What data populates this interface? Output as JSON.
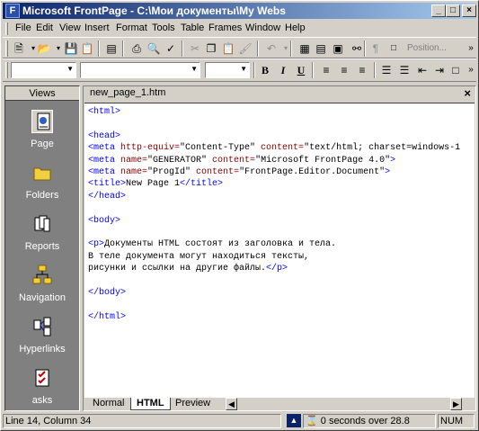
{
  "window": {
    "title": "Microsoft FrontPage - C:\\Мои документы\\My Webs",
    "minimize": "_",
    "maximize": "□",
    "close": "×"
  },
  "menu": [
    "File",
    "Edit",
    "View",
    "Insert",
    "Format",
    "Tools",
    "Table",
    "Frames",
    "Window",
    "Help"
  ],
  "toolbar": {
    "position_label": "Position..."
  },
  "views": {
    "header": "Views",
    "items": [
      {
        "label": "Page",
        "icon": "page-view-icon",
        "selected": true
      },
      {
        "label": "Folders",
        "icon": "folders-view-icon"
      },
      {
        "label": "Reports",
        "icon": "reports-view-icon"
      },
      {
        "label": "Navigation",
        "icon": "navigation-view-icon"
      },
      {
        "label": "Hyperlinks",
        "icon": "hyperlinks-view-icon"
      },
      {
        "label": "asks",
        "icon": "tasks-view-icon"
      }
    ]
  },
  "editor": {
    "document_tab": "new_page_1.htm",
    "close": "×",
    "code_lines": [
      "<html>",
      "",
      "<head>",
      "<meta http-equiv=\"Content-Type\" content=\"text/html; charset=windows-1",
      "<meta name=\"GENERATOR\" content=\"Microsoft FrontPage 4.0\">",
      "<meta name=\"ProgId\" content=\"FrontPage.Editor.Document\">",
      "<title>New Page 1</title>",
      "</head>",
      "",
      "<body>",
      "",
      "<p>Документы HTML состоят из заголовка и тела.",
      "В теле документа могут находиться тексты,",
      "рисунки и ссылки на другие файлы.</p>",
      "",
      "</body>",
      "",
      "</html>"
    ],
    "tabs": [
      "Normal",
      "HTML",
      "Preview"
    ],
    "active_tab": "HTML"
  },
  "status": {
    "position": "Line 14, Column 34",
    "download_time": "0 seconds over 28.8",
    "num": "NUM"
  },
  "colors": {
    "titlebar_start": "#0a246a",
    "titlebar_end": "#a6caf0",
    "tag": "#0000ff",
    "attr": "#800000"
  }
}
